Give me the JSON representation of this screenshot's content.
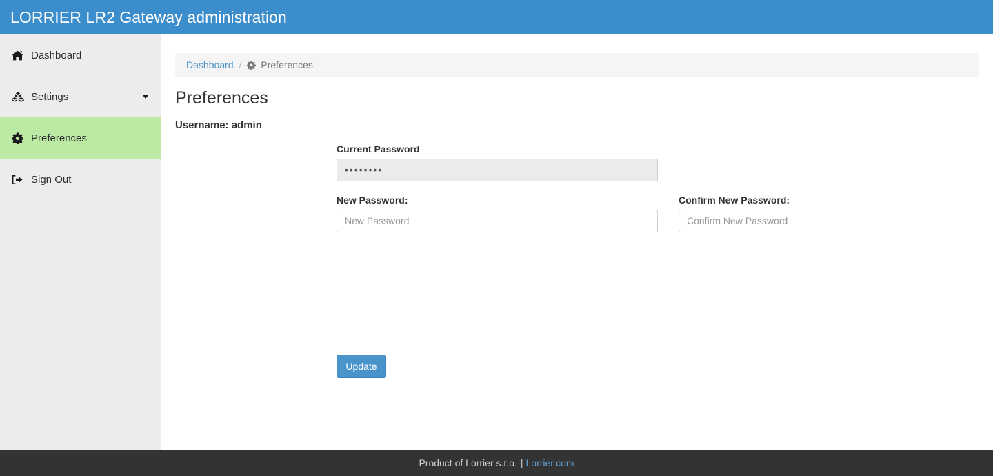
{
  "header": {
    "title": "LORRIER LR2 Gateway administration",
    "background": "#3c8dcc"
  },
  "sidebar": {
    "background": "#ececec",
    "active_background": "#bce9a3",
    "items": [
      {
        "label": "Dashboard",
        "icon": "home-icon",
        "active": false,
        "has_caret": false
      },
      {
        "label": "Settings",
        "icon": "cubes-icon",
        "active": false,
        "has_caret": true
      },
      {
        "label": "Preferences",
        "icon": "gear-icon",
        "active": true,
        "has_caret": false
      },
      {
        "label": "Sign Out",
        "icon": "sign-out-icon",
        "active": false,
        "has_caret": false
      }
    ]
  },
  "breadcrumb": {
    "home_label": "Dashboard",
    "separator": "/",
    "current_icon": "gear-icon",
    "current_label": "Preferences"
  },
  "main": {
    "page_title": "Preferences",
    "username_line": "Username: admin",
    "fields": {
      "current_password": {
        "label": "Current Password",
        "value": "••••••••",
        "placeholder": "",
        "disabled": true
      },
      "new_password": {
        "label": "New Password:",
        "value": "",
        "placeholder": "New Password",
        "disabled": false
      },
      "confirm_new_password": {
        "label": "Confirm New Password:",
        "value": "",
        "placeholder": "Confirm New Password",
        "disabled": false
      }
    },
    "update_button": {
      "label": "Update",
      "color": "#4a94cc"
    }
  },
  "footer": {
    "text": "Product of Lorrier s.r.o.",
    "separator": "|",
    "link_label": "Lorrier.com",
    "background": "#333333"
  }
}
